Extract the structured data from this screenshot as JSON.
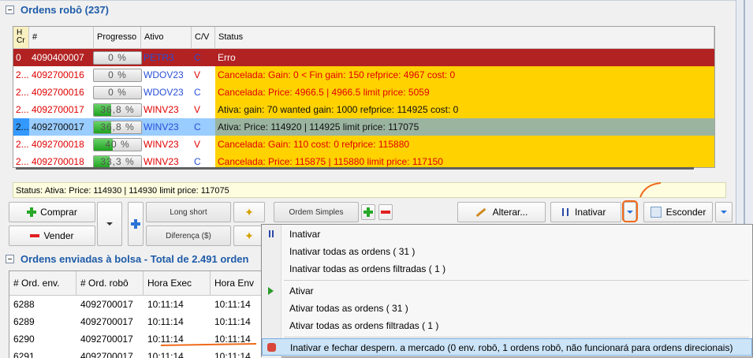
{
  "sections": {
    "robot_orders_title": "Ordens robô (237)",
    "sent_orders_title": "Ordens enviadas à bolsa - Total de 2.491 orden"
  },
  "robot_grid": {
    "headers": {
      "hcr_top": "H",
      "hcr_bottom": "Cr",
      "num": "#",
      "progress": "Progresso",
      "asset": "Ativo",
      "side": "C/V",
      "status": "Status"
    },
    "rows": [
      {
        "prefix": "0",
        "num": "4090400007",
        "progress_text": "0 %",
        "progress": 0,
        "asset": "PETR3",
        "side": "C",
        "status": "Erro",
        "style": "red"
      },
      {
        "prefix": "2...",
        "num": "4092700016",
        "progress_text": "0 %",
        "progress": 0,
        "asset": "WDOV23",
        "side": "V",
        "status": "Cancelada: Gain: 0 < Fin  gain: 150 refprice: 4967 cost: 0",
        "style": "yellow-red"
      },
      {
        "prefix": "2...",
        "num": "4092700016",
        "progress_text": "0 %",
        "progress": 0,
        "asset": "WDOV23",
        "side": "C",
        "status": "Cancelada: Price: 4966.5 | 4966.5 limit price: 5059",
        "style": "yellow-red"
      },
      {
        "prefix": "2...",
        "num": "4092700017",
        "progress_text": "36,8 %",
        "progress": 0.368,
        "asset": "WINV23",
        "side": "V",
        "status": "Ativa: gain: 70 wanted gain: 1000 refprice: 114925 cost: 0",
        "style": "yellow-black"
      },
      {
        "prefix": "2...",
        "num": "4092700017",
        "progress_text": "36,8 %",
        "progress": 0.368,
        "asset": "WINV23",
        "side": "C",
        "status": "Ativa: Price: 114920 | 114925 limit price: 117075",
        "style": "selected"
      },
      {
        "prefix": "2...",
        "num": "4092700018",
        "progress_text": "40 %",
        "progress": 0.4,
        "asset": "WINV23",
        "side": "V",
        "status": "Cancelada: Gain: 110 cost: 0 refprice: 115880",
        "style": "yellow-red"
      },
      {
        "prefix": "2...",
        "num": "4092700018",
        "progress_text": "33,3 %",
        "progress": 0.333,
        "asset": "WINV23",
        "side": "C",
        "status": "Cancelada: Price: 115875 | 115880 limit price: 117150",
        "style": "yellow-red"
      }
    ]
  },
  "status_bar": "Status: Ativa: Price: 114930 | 114930 limit price: 117075",
  "toolbar": {
    "buy": "Comprar",
    "sell": "Vender",
    "long_short": "Long short",
    "difference": "Diferença ($)",
    "simple_order": "Ordem Simples",
    "change": "Alterar...",
    "deactivate": "Inativar",
    "hide": "Esconder"
  },
  "sent_grid": {
    "headers": [
      "# Ord. env.",
      "# Ord. robô",
      "Hora Exec",
      "Hora Env"
    ],
    "rows": [
      [
        "6288",
        "4092700017",
        "10:11:14",
        "10:11:14"
      ],
      [
        "6289",
        "4092700017",
        "10:11:14",
        "10:11:14"
      ],
      [
        "6290",
        "4092700017",
        "10:11:14",
        "10:11:14"
      ],
      [
        "6291",
        "4092700017",
        "10:11:14",
        "10:11:14"
      ]
    ]
  },
  "menu": {
    "items": [
      {
        "label": "Inativar",
        "icon": "pause-icon"
      },
      {
        "label": "Inativar todas as ordens ( 31 )"
      },
      {
        "label": "Inativar todas as ordens filtradas ( 1 )"
      },
      {
        "label": "Ativar",
        "icon": "play-icon"
      },
      {
        "label": "Ativar todas as ordens ( 31 )"
      },
      {
        "label": "Ativar todas as ordens filtradas ( 1 )"
      },
      {
        "label": "Inativar e fechar despern. a mercado (0 env. robô, 1 ordens robô, não funcionará para ordens direcionais)",
        "icon": "close-market-icon"
      }
    ]
  },
  "colors": {
    "header_blue": "#1e5ba8",
    "row_error": "#b22222",
    "row_yellow": "#ffd200",
    "row_selected": "#9ab4a0",
    "annotation_orange": "#f06a1a"
  }
}
